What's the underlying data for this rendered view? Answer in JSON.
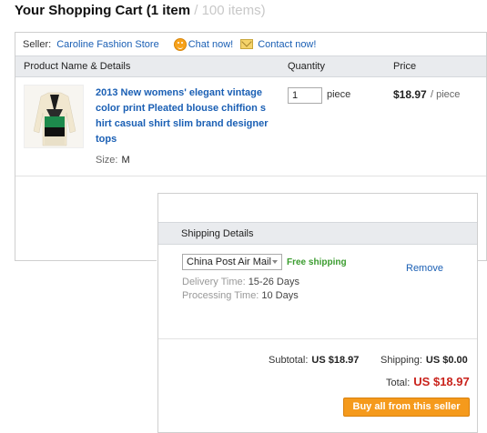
{
  "cart": {
    "title": "Your Shopping Cart",
    "count": "(1 item",
    "capacity": " / 100 items)"
  },
  "seller": {
    "label": "Seller:",
    "name": "Caroline Fashion Store",
    "chat_label": "Chat now!",
    "contact_label": "Contact now!"
  },
  "table": {
    "headers": [
      "Product Name & Details",
      "Quantity",
      "Price"
    ]
  },
  "product": {
    "title": "2013 New womens' elegant vintage color print Pleated blouse chiffion shirt casual shirt slim brand designer tops",
    "size_label": "Size:",
    "size_value": "M",
    "quantity": "1",
    "quantity_unit": "piece",
    "price": "$18.97",
    "price_unit": "/ piece"
  },
  "shipping": {
    "header": "Shipping Details",
    "method": "China Post Air Mail",
    "free_label": "Free shipping",
    "delivery_label": "Delivery Time:",
    "delivery_value": "15-26 Days",
    "processing_label": "Processing Time:",
    "processing_value": "10 Days",
    "remove_label": "Remove"
  },
  "totals": {
    "subtotal_label": "Subtotal:",
    "subtotal_value": "US $18.97",
    "shipping_label": "Shipping:",
    "shipping_value": "US $0.00",
    "total_label": "Total:",
    "total_value": "US $18.97",
    "buy_label": "Buy all from this seller"
  },
  "colors": {
    "link": "#1a5fb4",
    "free_shipping": "#3a9c2e",
    "total": "#c9231c",
    "buy_button": "#f59a1c"
  },
  "icons": [
    "chat-icon",
    "mail-icon",
    "chevron-down-icon",
    "product-thumbnail"
  ]
}
